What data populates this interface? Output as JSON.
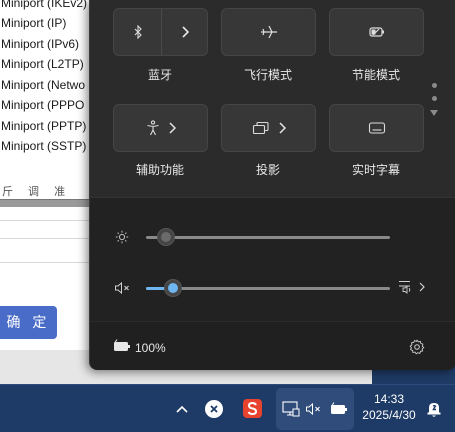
{
  "background_window": {
    "devices": [
      "Miniport (IKEv2)",
      "Miniport (IP)",
      "Miniport (IPv6)",
      "Miniport (L2TP)",
      "Miniport (Netwo",
      "Miniport (PPPO",
      "Miniport (PPTP)",
      "Miniport (SSTP)"
    ],
    "header_fragment": "斤 调 准",
    "ok_button": "确 定"
  },
  "quick_settings": {
    "tiles": [
      {
        "id": "bluetooth",
        "label": "蓝牙",
        "icon": "bluetooth-icon",
        "split": true
      },
      {
        "id": "airplane",
        "label": "飞行模式",
        "icon": "airplane-icon",
        "split": false
      },
      {
        "id": "energy-saver",
        "label": "节能模式",
        "icon": "energy-saver-icon",
        "split": false
      },
      {
        "id": "accessibility",
        "label": "辅助功能",
        "icon": "accessibility-icon",
        "split": false
      },
      {
        "id": "project",
        "label": "投影",
        "icon": "project-icon",
        "split": false
      },
      {
        "id": "live-captions",
        "label": "实时字幕",
        "icon": "live-captions-icon",
        "split": false
      }
    ],
    "brightness": {
      "icon": "brightness-icon",
      "value_percent": 8
    },
    "volume": {
      "icon": "volume-muted-icon",
      "value_percent": 11,
      "accent": "#6fb6f0",
      "output_icon": "audio-output-icon"
    },
    "battery": {
      "icon": "battery-charging-icon",
      "text": "100%"
    },
    "settings_icon": "gear-icon"
  },
  "taskbar": {
    "tray_icons": [
      "chevron-up-icon",
      "x-circle-icon",
      "sogou-ime-icon"
    ],
    "status_icons": [
      "network-icon",
      "volume-muted-icon",
      "battery-charging-icon"
    ],
    "time": "14:33",
    "date": "2025/4/30",
    "notification_icon": "notification-icon"
  },
  "colors": {
    "accent": "#6fb6f0",
    "panel": "#2b2b2b",
    "taskbar": "#1e3a66",
    "ok_button": "#4a6cc9"
  }
}
